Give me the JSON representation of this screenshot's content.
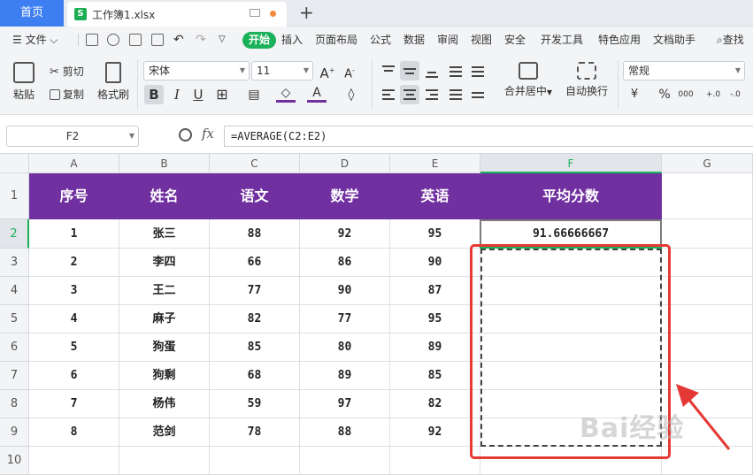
{
  "tabs": {
    "home": "首页",
    "document": "工作簿1.xlsx"
  },
  "menu": {
    "file": "文件",
    "items": [
      "开始",
      "插入",
      "页面布局",
      "公式",
      "数据",
      "审阅",
      "视图",
      "安全",
      "开发工具",
      "特色应用",
      "文档助手"
    ],
    "search": "查找"
  },
  "ribbon": {
    "paste": "粘贴",
    "cut": "剪切",
    "copy": "复制",
    "format_painter": "格式刷",
    "font_name": "宋体",
    "font_size": "11",
    "bold": "B",
    "italic": "I",
    "underline": "U",
    "merge_center": "合并居中",
    "wrap_text": "自动换行",
    "number_format": "常规",
    "percent": "%",
    "comma": "000"
  },
  "formula_bar": {
    "cell_ref": "F2",
    "fx": "fx",
    "formula": "=AVERAGE(C2:E2)"
  },
  "sheet": {
    "columns": [
      "A",
      "B",
      "C",
      "D",
      "E",
      "F",
      "G"
    ],
    "rows": [
      "1",
      "2",
      "3",
      "4",
      "5",
      "6",
      "7",
      "8",
      "9",
      "10"
    ],
    "headers": [
      "序号",
      "姓名",
      "语文",
      "数学",
      "英语",
      "平均分数"
    ],
    "data": [
      [
        "1",
        "张三",
        "88",
        "92",
        "95",
        "91.66666667"
      ],
      [
        "2",
        "李四",
        "66",
        "86",
        "90",
        ""
      ],
      [
        "3",
        "王二",
        "77",
        "90",
        "87",
        ""
      ],
      [
        "4",
        "麻子",
        "82",
        "77",
        "95",
        ""
      ],
      [
        "5",
        "狗蛋",
        "85",
        "80",
        "89",
        ""
      ],
      [
        "6",
        "狗剩",
        "68",
        "89",
        "85",
        ""
      ],
      [
        "7",
        "杨伟",
        "59",
        "97",
        "82",
        ""
      ],
      [
        "8",
        "范剑",
        "78",
        "88",
        "92",
        ""
      ]
    ]
  },
  "watermark": "Bai经验",
  "colors": {
    "header_purple": "#7030a0",
    "accent_green": "#1bb15a",
    "annotation_red": "#e53935",
    "home_tab_blue": "#3d7ff0"
  }
}
